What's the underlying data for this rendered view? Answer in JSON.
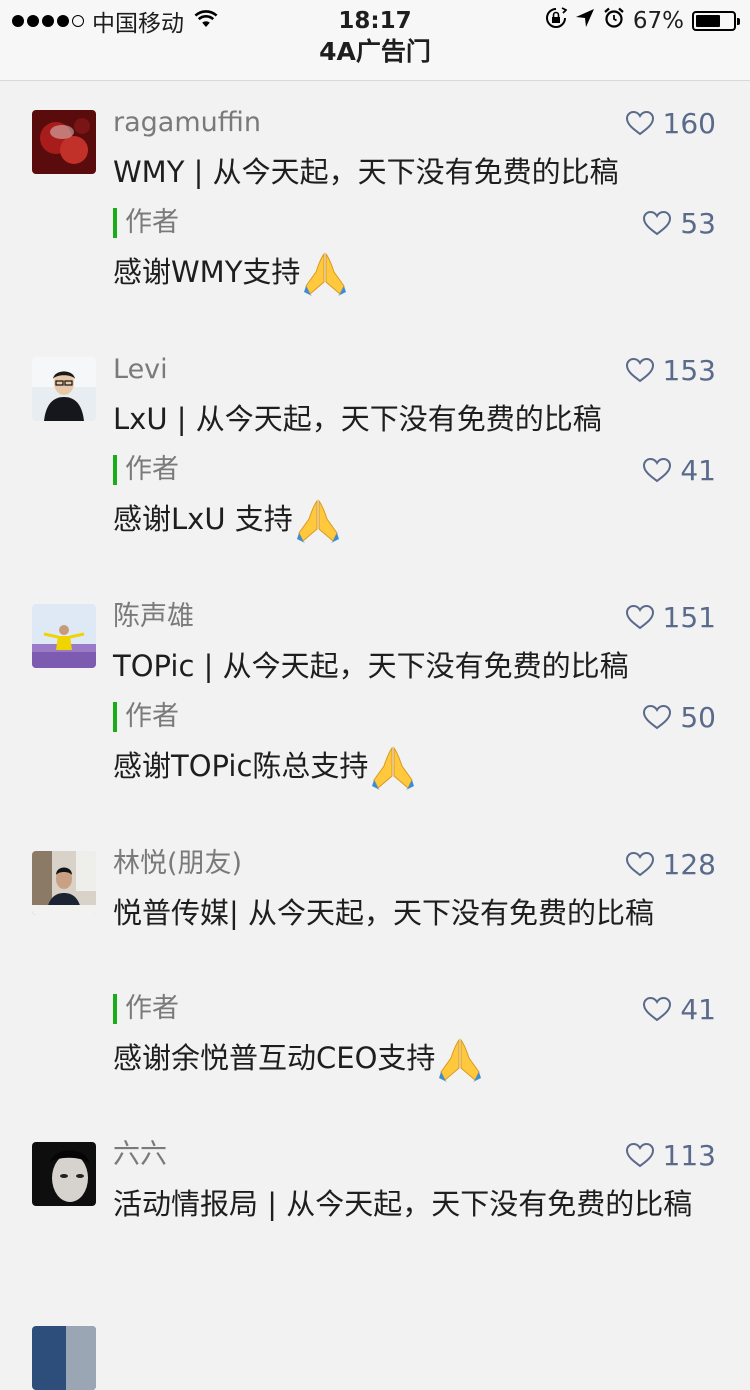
{
  "status_bar": {
    "carrier": "中国移动",
    "time": "18:17",
    "battery_text": "67%",
    "battery_level": 0.67
  },
  "nav": {
    "title": "4A广告门"
  },
  "author_label": "作者",
  "reply_emoji_icon": "folded-hands-emoji",
  "comments": [
    {
      "name": "ragamuffin",
      "likes": "160",
      "text": "WMY | 从今天起，天下没有免费的比稿",
      "reply": {
        "likes": "53",
        "text": "感谢WMY支持"
      }
    },
    {
      "name": "Levi",
      "likes": "153",
      "text": "LxU | 从今天起，天下没有免费的比稿",
      "reply": {
        "likes": "41",
        "text": "感谢LxU 支持"
      }
    },
    {
      "name": "陈声雄",
      "likes": "151",
      "text": "TOPic | 从今天起，天下没有免费的比稿",
      "reply": {
        "likes": "50",
        "text": "感谢TOPic陈总支持"
      }
    },
    {
      "name": "林悦(朋友)",
      "likes": "128",
      "text": "悦普传媒| 从今天起，天下没有免费的比稿",
      "reply": {
        "likes": "41",
        "text": "感谢余悦普互动CEO支持"
      }
    },
    {
      "name": "六六",
      "likes": "113",
      "text": "活动情报局 | 从今天起，天下没有免费的比稿"
    }
  ],
  "colors": {
    "reply_bar": "#1aad19",
    "like": "#5a6a8a",
    "name": "#7a7a7a"
  }
}
